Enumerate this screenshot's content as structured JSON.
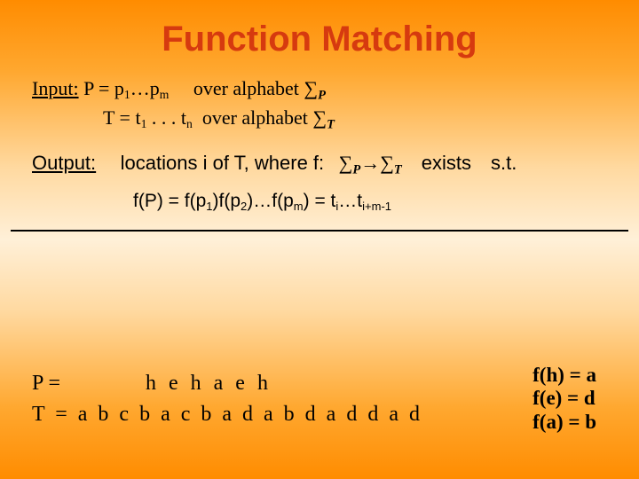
{
  "title": "Function Matching",
  "input": {
    "label": "Input:",
    "P_left": "P = p",
    "P_sub1": "1",
    "P_mid": "…p",
    "P_subm": "m",
    "P_right": "over alphabet",
    "T_left": "T = t",
    "T_sub1": "1",
    "T_mid": " .  .  .  t",
    "T_subn": "n",
    "T_right": "over alphabet"
  },
  "sigma": "∑",
  "sigma_P": "P",
  "sigma_T": "T",
  "output": {
    "label": "Output:",
    "text1": "locations i of T,  where  f:",
    "arrow": "→",
    "exists": "exists",
    "st": "s.t."
  },
  "fP": {
    "a": "f(P) = f(p",
    "s1": "1",
    "b": ")f(p",
    "s2": "2",
    "c": ")…f(p",
    "sm": "m",
    "d": ")  =  t",
    "si": "i",
    "e": "…t",
    "sim": "i+m-1"
  },
  "example": {
    "P_label": "P =",
    "P_value": "h e h a e h",
    "T_label": "T =",
    "T_value": "a b c b a c b a d a b d a d d a d"
  },
  "map": {
    "l1": "f(h) = a",
    "l2": "f(e) = d",
    "l3": "f(a) = b"
  }
}
